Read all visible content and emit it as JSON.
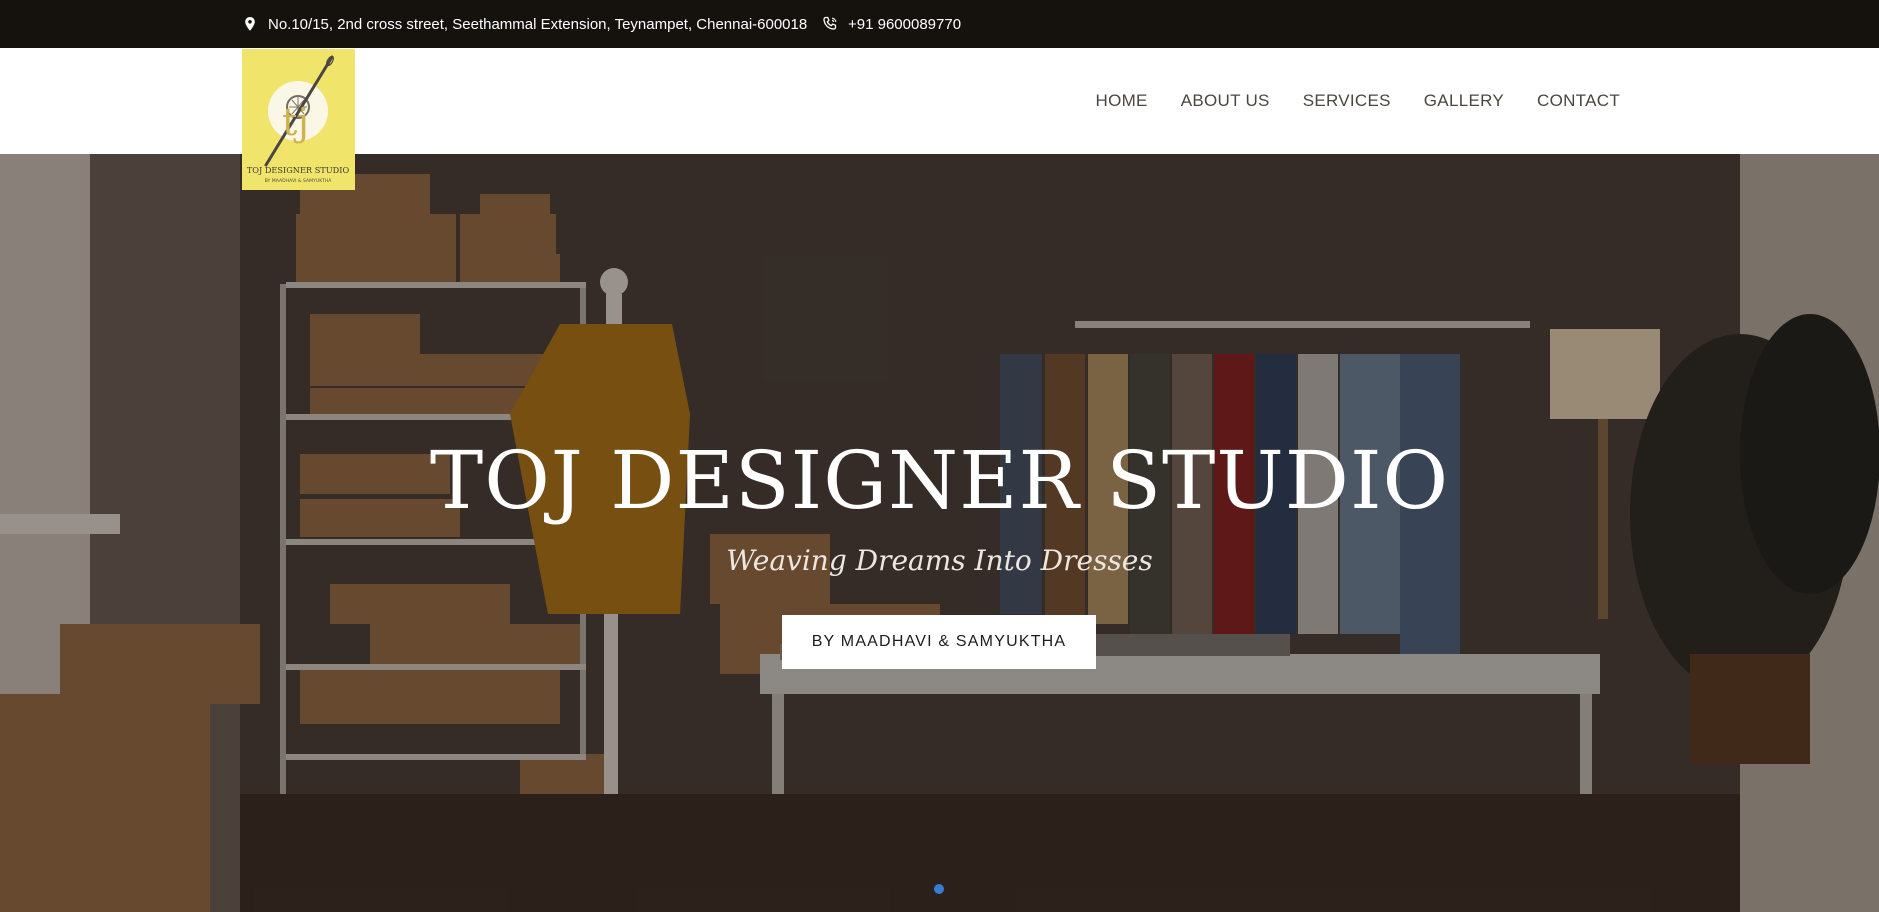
{
  "topbar": {
    "address": "No.10/15, 2nd cross street, Seethammal Extension, Teynampet, Chennai-600018",
    "phone": "+91 9600089770",
    "address_icon": "map-pin-icon",
    "phone_icon": "phone-icon"
  },
  "logo": {
    "monogram": "tj",
    "name": "TOJ DESIGNER STUDIO",
    "tagline": "BY MAADHAVI & SAMYUKTHA",
    "bg_color": "#f0e46a"
  },
  "nav": {
    "items": [
      {
        "label": "HOME"
      },
      {
        "label": "ABOUT US"
      },
      {
        "label": "SERVICES"
      },
      {
        "label": "GALLERY"
      },
      {
        "label": "CONTACT"
      }
    ]
  },
  "hero": {
    "title": "TOJ DESIGNER STUDIO",
    "tagline": "Weaving Dreams Into Dresses",
    "button_label": "BY MAADHAVI & SAMYUKTHA",
    "slides": 1,
    "active_slide": 1,
    "dot_color": "#3a7bd5"
  }
}
